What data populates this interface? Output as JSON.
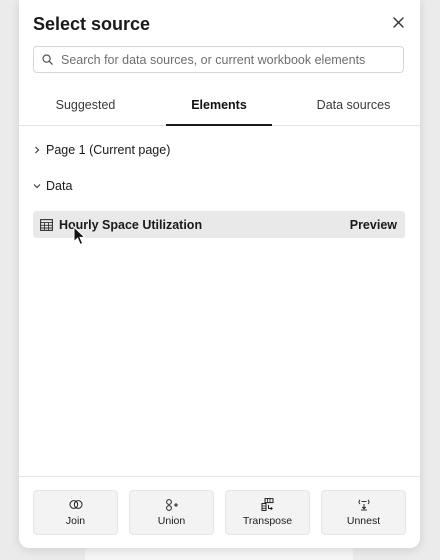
{
  "dialog": {
    "title": "Select source"
  },
  "search": {
    "placeholder": "Search for data sources, or current workbook elements",
    "value": ""
  },
  "tabs": [
    {
      "label": "Suggested",
      "active": false
    },
    {
      "label": "Elements",
      "active": true
    },
    {
      "label": "Data sources",
      "active": false
    }
  ],
  "tree": {
    "page_label": "Page 1 (Current page)",
    "data_label": "Data"
  },
  "element": {
    "name": "Hourly Space Utilization",
    "preview_label": "Preview",
    "icon": "table-icon"
  },
  "actions": [
    {
      "label": "Join",
      "icon": "join-icon"
    },
    {
      "label": "Union",
      "icon": "union-icon"
    },
    {
      "label": "Transpose",
      "icon": "transpose-icon"
    },
    {
      "label": "Unnest",
      "icon": "unnest-icon"
    }
  ],
  "colors": {
    "row_highlight": "#e9e9e9",
    "active_tab_underline": "#1a1a1a",
    "button_bg": "#f3f3f3"
  }
}
